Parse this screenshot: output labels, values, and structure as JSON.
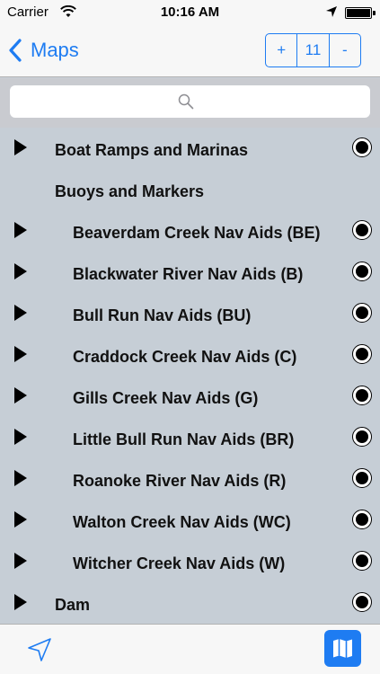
{
  "status_bar": {
    "carrier": "Carrier",
    "time": "10:16 AM"
  },
  "nav": {
    "back_label": "Maps",
    "zoom_in": "+",
    "zoom_level": "11",
    "zoom_out": "-"
  },
  "search": {
    "placeholder": ""
  },
  "layers": [
    {
      "label": "Boat Ramps and Marinas",
      "indent": 0,
      "expandable": true,
      "selected": true
    },
    {
      "label": "Buoys and Markers",
      "indent": 0,
      "expandable": false,
      "selected": false
    },
    {
      "label": "Beaverdam Creek Nav Aids (BE)",
      "indent": 1,
      "expandable": true,
      "selected": true
    },
    {
      "label": "Blackwater River Nav Aids (B)",
      "indent": 1,
      "expandable": true,
      "selected": true
    },
    {
      "label": "Bull Run Nav Aids (BU)",
      "indent": 1,
      "expandable": true,
      "selected": true
    },
    {
      "label": "Craddock Creek Nav Aids (C)",
      "indent": 1,
      "expandable": true,
      "selected": true
    },
    {
      "label": "Gills Creek Nav Aids (G)",
      "indent": 1,
      "expandable": true,
      "selected": true
    },
    {
      "label": "Little Bull Run Nav Aids (BR)",
      "indent": 1,
      "expandable": true,
      "selected": true
    },
    {
      "label": "Roanoke River Nav Aids (R)",
      "indent": 1,
      "expandable": true,
      "selected": true
    },
    {
      "label": "Walton Creek Nav Aids  (WC)",
      "indent": 1,
      "expandable": true,
      "selected": true
    },
    {
      "label": "Witcher Creek Nav Aids (W)",
      "indent": 1,
      "expandable": true,
      "selected": true
    },
    {
      "label": "Dam",
      "indent": 0,
      "expandable": true,
      "selected": true
    }
  ],
  "colors": {
    "accent": "#1e7cf2",
    "list_background": "#c6ced6"
  },
  "icons": {
    "back": "chevron-left-icon",
    "search": "search-icon",
    "expand": "triangle-right-icon",
    "selected": "radio-selected-icon",
    "locate": "location-arrow-icon",
    "map": "map-icon"
  }
}
